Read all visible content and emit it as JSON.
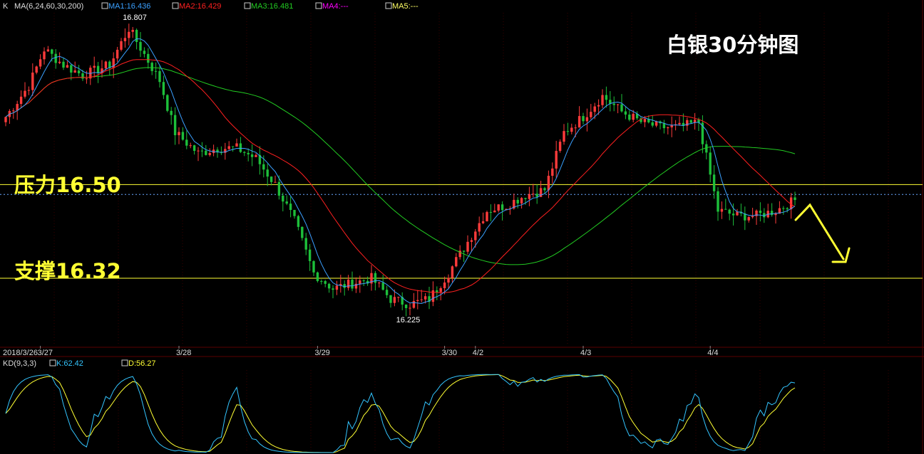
{
  "header": {
    "chart_type_label": "K",
    "ma_params": "MA(6,24,60,30,200)",
    "ma1": "MA1:16.436",
    "ma2": "MA2:16.429",
    "ma3": "MA3:16.481",
    "ma4": "MA4:---",
    "ma5": "MA5:---"
  },
  "annotations": {
    "title": "白银30分钟图",
    "resistance": "压力16.50",
    "support": "支撑16.32",
    "high_label": "16.807",
    "low_label": "16.225"
  },
  "kd_panel": {
    "label": "KD(9,3,3)",
    "k_label": "K:62.42",
    "d_label": "D:56.27"
  },
  "colors": {
    "background": "#000000",
    "up_candle": "#ff3b3b",
    "down_candle": "#1dbf3a",
    "ma1": "#3aa0ff",
    "ma2": "#ff2020",
    "ma3": "#22cc22",
    "ma4": "#ff00ff",
    "ma5": "#ffff66",
    "level_line": "#ffff33",
    "k_line": "#33c5ff",
    "d_line": "#ffff33",
    "grid": "#3a0000"
  },
  "chart_data": {
    "type": "candlestick",
    "title": "白银30分钟图",
    "x_labels": [
      "2018/3/26",
      "3/27",
      "3/28",
      "3/29",
      "3/30",
      "4/2",
      "4/3",
      "4/4"
    ],
    "x_label_bar_index": [
      0,
      9,
      45,
      81,
      114,
      122,
      150,
      183
    ],
    "ylim": [
      16.19,
      16.83
    ],
    "price_waypoints_bar_index": [
      0,
      6,
      10,
      15,
      20,
      27,
      32,
      40,
      44,
      50,
      55,
      60,
      65,
      70,
      75,
      80,
      85,
      90,
      95,
      100,
      105,
      110,
      115,
      120,
      125,
      130,
      135,
      140,
      145,
      150,
      155,
      160,
      165,
      170,
      175,
      180,
      185,
      190,
      195,
      200,
      205
    ],
    "price_waypoints": [
      16.63,
      16.69,
      16.76,
      16.73,
      16.71,
      16.73,
      16.8,
      16.7,
      16.6,
      16.56,
      16.57,
      16.57,
      16.55,
      16.5,
      16.43,
      16.33,
      16.3,
      16.31,
      16.32,
      16.28,
      16.27,
      16.28,
      16.33,
      16.39,
      16.45,
      16.46,
      16.48,
      16.49,
      16.6,
      16.63,
      16.67,
      16.64,
      16.62,
      16.61,
      16.61,
      16.62,
      16.45,
      16.44,
      16.44,
      16.45,
      16.47
    ],
    "levels": [
      {
        "label": "压力16.50",
        "value": 16.5
      },
      {
        "label": "支撑16.32",
        "value": 16.32
      }
    ],
    "current_price_line": 16.481,
    "high": {
      "label": "16.807",
      "value": 16.807
    },
    "low": {
      "label": "16.225",
      "value": 16.225
    },
    "series": [
      {
        "name": "MA1",
        "period": 6,
        "last": 16.436
      },
      {
        "name": "MA2",
        "period": 24,
        "last": 16.429
      },
      {
        "name": "MA3",
        "period": 60,
        "last": 16.481
      }
    ],
    "kd": {
      "k_last": 62.42,
      "d_last": 56.27,
      "ylim": [
        0,
        100
      ]
    }
  }
}
